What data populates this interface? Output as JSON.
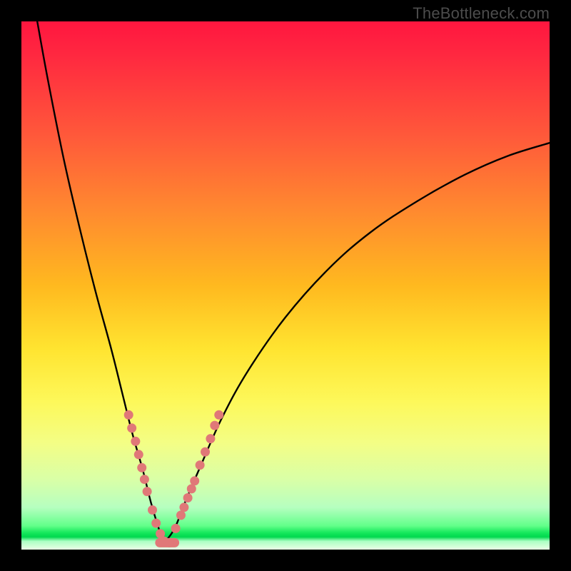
{
  "watermark": "TheBottleneck.com",
  "colors": {
    "curve_stroke": "#000000",
    "marker_fill": "#e07878",
    "marker_stroke": "#b85a5a",
    "bg_black": "#000000"
  },
  "chart_data": {
    "type": "line",
    "title": "",
    "xlabel": "",
    "ylabel": "",
    "xlim": [
      0,
      100
    ],
    "ylim": [
      0,
      100
    ],
    "note": "Axes are unlabeled; x/y in percent of plot area, y=0 at bottom. Curve is a bottleneck V-shape with minimum near x≈27. Two curve segments listed separately (left descending arm, right ascending arm). Marker points are scatter overlays along the lower parts of both arms.",
    "series": [
      {
        "name": "left-arm",
        "x": [
          3,
          5,
          8,
          11,
          14,
          17,
          19,
          21,
          23,
          24.5,
          26,
          27
        ],
        "y": [
          100,
          89,
          74,
          61,
          49,
          38,
          30,
          22,
          15,
          9,
          4,
          1.2
        ]
      },
      {
        "name": "right-arm",
        "x": [
          27,
          29,
          31,
          34,
          38,
          43,
          50,
          58,
          66,
          75,
          84,
          92,
          100
        ],
        "y": [
          1.2,
          4,
          9,
          16,
          25,
          34,
          44,
          53,
          60,
          66,
          71,
          74.5,
          77
        ]
      }
    ],
    "markers_left": {
      "x": [
        20.3,
        20.9,
        21.6,
        22.2,
        22.8,
        23.3,
        23.8,
        24.8,
        25.5,
        26.3,
        27.0,
        28.0
      ],
      "y": [
        25.5,
        23.0,
        20.5,
        18.0,
        15.5,
        13.3,
        11.0,
        7.5,
        5.0,
        3.0,
        1.6,
        1.3
      ]
    },
    "markers_right": {
      "x": [
        29.2,
        30.2,
        30.8,
        31.5,
        32.2,
        32.8,
        33.8,
        34.8,
        35.8,
        36.6,
        37.4
      ],
      "y": [
        4.0,
        6.5,
        8.0,
        9.8,
        11.5,
        13.0,
        16.0,
        18.5,
        21.0,
        23.5,
        25.5
      ]
    },
    "trough_bar": {
      "x": [
        26.2,
        29.0
      ],
      "y": [
        1.3,
        1.3
      ]
    }
  }
}
